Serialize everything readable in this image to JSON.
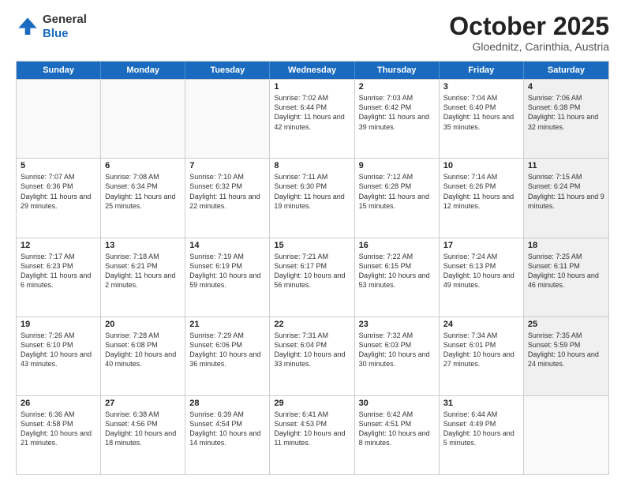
{
  "header": {
    "logo_general": "General",
    "logo_blue": "Blue",
    "month_title": "October 2025",
    "location": "Gloednitz, Carinthia, Austria"
  },
  "days_of_week": [
    "Sunday",
    "Monday",
    "Tuesday",
    "Wednesday",
    "Thursday",
    "Friday",
    "Saturday"
  ],
  "weeks": [
    [
      {
        "day": "",
        "sunrise": "",
        "sunset": "",
        "daylight": "",
        "empty": true
      },
      {
        "day": "",
        "sunrise": "",
        "sunset": "",
        "daylight": "",
        "empty": true
      },
      {
        "day": "",
        "sunrise": "",
        "sunset": "",
        "daylight": "",
        "empty": true
      },
      {
        "day": "1",
        "sunrise": "Sunrise: 7:02 AM",
        "sunset": "Sunset: 6:44 PM",
        "daylight": "Daylight: 11 hours and 42 minutes.",
        "empty": false
      },
      {
        "day": "2",
        "sunrise": "Sunrise: 7:03 AM",
        "sunset": "Sunset: 6:42 PM",
        "daylight": "Daylight: 11 hours and 39 minutes.",
        "empty": false
      },
      {
        "day": "3",
        "sunrise": "Sunrise: 7:04 AM",
        "sunset": "Sunset: 6:40 PM",
        "daylight": "Daylight: 11 hours and 35 minutes.",
        "empty": false
      },
      {
        "day": "4",
        "sunrise": "Sunrise: 7:06 AM",
        "sunset": "Sunset: 6:38 PM",
        "daylight": "Daylight: 11 hours and 32 minutes.",
        "empty": false,
        "shaded": true
      }
    ],
    [
      {
        "day": "5",
        "sunrise": "Sunrise: 7:07 AM",
        "sunset": "Sunset: 6:36 PM",
        "daylight": "Daylight: 11 hours and 29 minutes.",
        "empty": false
      },
      {
        "day": "6",
        "sunrise": "Sunrise: 7:08 AM",
        "sunset": "Sunset: 6:34 PM",
        "daylight": "Daylight: 11 hours and 25 minutes.",
        "empty": false
      },
      {
        "day": "7",
        "sunrise": "Sunrise: 7:10 AM",
        "sunset": "Sunset: 6:32 PM",
        "daylight": "Daylight: 11 hours and 22 minutes.",
        "empty": false
      },
      {
        "day": "8",
        "sunrise": "Sunrise: 7:11 AM",
        "sunset": "Sunset: 6:30 PM",
        "daylight": "Daylight: 11 hours and 19 minutes.",
        "empty": false
      },
      {
        "day": "9",
        "sunrise": "Sunrise: 7:12 AM",
        "sunset": "Sunset: 6:28 PM",
        "daylight": "Daylight: 11 hours and 15 minutes.",
        "empty": false
      },
      {
        "day": "10",
        "sunrise": "Sunrise: 7:14 AM",
        "sunset": "Sunset: 6:26 PM",
        "daylight": "Daylight: 11 hours and 12 minutes.",
        "empty": false
      },
      {
        "day": "11",
        "sunrise": "Sunrise: 7:15 AM",
        "sunset": "Sunset: 6:24 PM",
        "daylight": "Daylight: 11 hours and 9 minutes.",
        "empty": false,
        "shaded": true
      }
    ],
    [
      {
        "day": "12",
        "sunrise": "Sunrise: 7:17 AM",
        "sunset": "Sunset: 6:23 PM",
        "daylight": "Daylight: 11 hours and 6 minutes.",
        "empty": false
      },
      {
        "day": "13",
        "sunrise": "Sunrise: 7:18 AM",
        "sunset": "Sunset: 6:21 PM",
        "daylight": "Daylight: 11 hours and 2 minutes.",
        "empty": false
      },
      {
        "day": "14",
        "sunrise": "Sunrise: 7:19 AM",
        "sunset": "Sunset: 6:19 PM",
        "daylight": "Daylight: 10 hours and 59 minutes.",
        "empty": false
      },
      {
        "day": "15",
        "sunrise": "Sunrise: 7:21 AM",
        "sunset": "Sunset: 6:17 PM",
        "daylight": "Daylight: 10 hours and 56 minutes.",
        "empty": false
      },
      {
        "day": "16",
        "sunrise": "Sunrise: 7:22 AM",
        "sunset": "Sunset: 6:15 PM",
        "daylight": "Daylight: 10 hours and 53 minutes.",
        "empty": false
      },
      {
        "day": "17",
        "sunrise": "Sunrise: 7:24 AM",
        "sunset": "Sunset: 6:13 PM",
        "daylight": "Daylight: 10 hours and 49 minutes.",
        "empty": false
      },
      {
        "day": "18",
        "sunrise": "Sunrise: 7:25 AM",
        "sunset": "Sunset: 6:11 PM",
        "daylight": "Daylight: 10 hours and 46 minutes.",
        "empty": false,
        "shaded": true
      }
    ],
    [
      {
        "day": "19",
        "sunrise": "Sunrise: 7:26 AM",
        "sunset": "Sunset: 6:10 PM",
        "daylight": "Daylight: 10 hours and 43 minutes.",
        "empty": false
      },
      {
        "day": "20",
        "sunrise": "Sunrise: 7:28 AM",
        "sunset": "Sunset: 6:08 PM",
        "daylight": "Daylight: 10 hours and 40 minutes.",
        "empty": false
      },
      {
        "day": "21",
        "sunrise": "Sunrise: 7:29 AM",
        "sunset": "Sunset: 6:06 PM",
        "daylight": "Daylight: 10 hours and 36 minutes.",
        "empty": false
      },
      {
        "day": "22",
        "sunrise": "Sunrise: 7:31 AM",
        "sunset": "Sunset: 6:04 PM",
        "daylight": "Daylight: 10 hours and 33 minutes.",
        "empty": false
      },
      {
        "day": "23",
        "sunrise": "Sunrise: 7:32 AM",
        "sunset": "Sunset: 6:03 PM",
        "daylight": "Daylight: 10 hours and 30 minutes.",
        "empty": false
      },
      {
        "day": "24",
        "sunrise": "Sunrise: 7:34 AM",
        "sunset": "Sunset: 6:01 PM",
        "daylight": "Daylight: 10 hours and 27 minutes.",
        "empty": false
      },
      {
        "day": "25",
        "sunrise": "Sunrise: 7:35 AM",
        "sunset": "Sunset: 5:59 PM",
        "daylight": "Daylight: 10 hours and 24 minutes.",
        "empty": false,
        "shaded": true
      }
    ],
    [
      {
        "day": "26",
        "sunrise": "Sunrise: 6:36 AM",
        "sunset": "Sunset: 4:58 PM",
        "daylight": "Daylight: 10 hours and 21 minutes.",
        "empty": false
      },
      {
        "day": "27",
        "sunrise": "Sunrise: 6:38 AM",
        "sunset": "Sunset: 4:56 PM",
        "daylight": "Daylight: 10 hours and 18 minutes.",
        "empty": false
      },
      {
        "day": "28",
        "sunrise": "Sunrise: 6:39 AM",
        "sunset": "Sunset: 4:54 PM",
        "daylight": "Daylight: 10 hours and 14 minutes.",
        "empty": false
      },
      {
        "day": "29",
        "sunrise": "Sunrise: 6:41 AM",
        "sunset": "Sunset: 4:53 PM",
        "daylight": "Daylight: 10 hours and 11 minutes.",
        "empty": false
      },
      {
        "day": "30",
        "sunrise": "Sunrise: 6:42 AM",
        "sunset": "Sunset: 4:51 PM",
        "daylight": "Daylight: 10 hours and 8 minutes.",
        "empty": false
      },
      {
        "day": "31",
        "sunrise": "Sunrise: 6:44 AM",
        "sunset": "Sunset: 4:49 PM",
        "daylight": "Daylight: 10 hours and 5 minutes.",
        "empty": false
      },
      {
        "day": "",
        "sunrise": "",
        "sunset": "",
        "daylight": "",
        "empty": true,
        "shaded": true
      }
    ]
  ]
}
